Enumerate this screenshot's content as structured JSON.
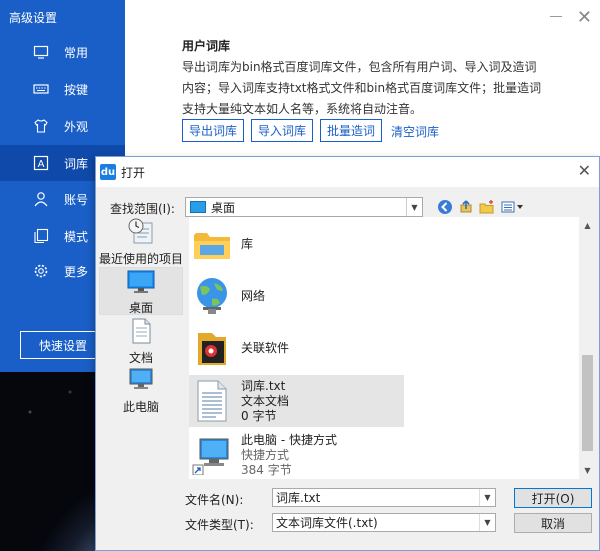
{
  "settings_window": {
    "title": "高级设置",
    "nav": [
      {
        "label": "常用",
        "icon": "monitor-icon"
      },
      {
        "label": "按键",
        "icon": "keyboard-icon"
      },
      {
        "label": "外观",
        "icon": "shirt-icon"
      },
      {
        "label": "词库",
        "icon": "lexicon-icon",
        "active": true
      },
      {
        "label": "账号",
        "icon": "user-icon"
      },
      {
        "label": "模式",
        "icon": "copy-icon"
      },
      {
        "label": "更多",
        "icon": "gear-icon"
      }
    ],
    "quick_setup": "快速设置",
    "section": {
      "title": "用户词库",
      "description": "导出词库为bin格式百度词库文件，包含所有用户词、导入词及造词内容；导入词库支持txt格式文件和bin格式百度词库文件；批量造词支持大量纯文本如人名等，系统将自动注音。",
      "buttons": {
        "export": "导出词库",
        "import": "导入词库",
        "batch": "批量造词",
        "clear": "清空词库"
      }
    },
    "colors": {
      "sidebar": "#1a5fc7",
      "accent": "#1a5fc7"
    }
  },
  "dialog": {
    "title": "打开",
    "look_in_label": "查找范围(I):",
    "look_in_value": "桌面",
    "places": [
      {
        "label": "最近使用的项目",
        "icon": "recent-icon"
      },
      {
        "label": "桌面",
        "icon": "desktop-icon",
        "selected": true
      },
      {
        "label": "文档",
        "icon": "documents-icon"
      },
      {
        "label": "此电脑",
        "icon": "computer-icon"
      }
    ],
    "files": [
      {
        "name": "库",
        "icon": "library-folder-icon"
      },
      {
        "name": "网络",
        "icon": "network-icon"
      },
      {
        "name": "关联软件",
        "icon": "folder-icon"
      },
      {
        "name": "词库.txt",
        "type": "文本文档",
        "size": "0 字节",
        "icon": "text-file-icon",
        "selected": true
      },
      {
        "name": "此电脑 - 快捷方式",
        "type": "快捷方式",
        "size": "384 字节",
        "icon": "computer-shortcut-icon"
      }
    ],
    "filename_label": "文件名(N):",
    "filename_value": "词库.txt",
    "filetype_label": "文件类型(T):",
    "filetype_value": "文本词库文件(.txt)",
    "open_button": "打开(O)",
    "cancel_button": "取消"
  }
}
